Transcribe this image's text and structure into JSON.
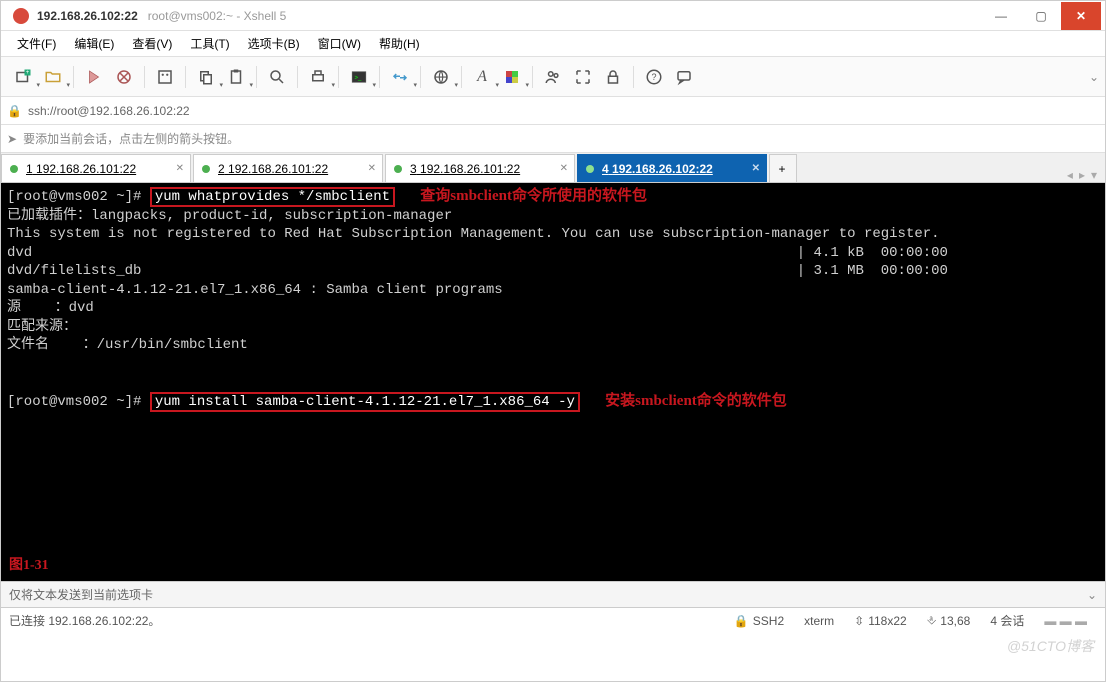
{
  "titlebar": {
    "ip": "192.168.26.102:22",
    "subtitle": "root@vms002:~ - Xshell 5"
  },
  "menu": [
    "文件(F)",
    "编辑(E)",
    "查看(V)",
    "工具(T)",
    "选项卡(B)",
    "窗口(W)",
    "帮助(H)"
  ],
  "address": "ssh://root@192.168.26.102:22",
  "hint": "要添加当前会话，点击左侧的箭头按钮。",
  "tabs": [
    {
      "num": "1",
      "label": "192.168.26.101:22"
    },
    {
      "num": "2",
      "label": "192.168.26.101:22"
    },
    {
      "num": "3",
      "label": "192.168.26.101:22"
    },
    {
      "num": "4",
      "label": "192.168.26.102:22"
    }
  ],
  "term": {
    "prompt1": "[root@vms002 ~]# ",
    "cmd1": "yum whatprovides */smbclient",
    "anno1": "查询smbclient命令所使用的软件包",
    "out_lines": [
      "已加载插件：langpacks, product-id, subscription-manager",
      "This system is not registered to Red Hat Subscription Management. You can use subscription-manager to register.",
      "dvd                                                                                           | 4.1 kB  00:00:00",
      "dvd/filelists_db                                                                              | 3.1 MB  00:00:00",
      "samba-client-4.1.12-21.el7_1.x86_64 : Samba client programs",
      "源    ：dvd",
      "匹配来源：",
      "文件名    ：/usr/bin/smbclient"
    ],
    "prompt2": "[root@vms002 ~]# ",
    "cmd2": "yum install samba-client-4.1.12-21.el7_1.x86_64 -y",
    "anno2": "安装smbclient命令的软件包",
    "fig": "图1-31"
  },
  "statustop": {
    "left": "仅将文本发送到当前选项卡"
  },
  "status": {
    "left": "已连接 192.168.26.102:22。",
    "proto": "SSH2",
    "term": "xterm",
    "size": "118x22",
    "cursor": "13,68",
    "sessions": "4 会话"
  },
  "watermark": "@51CTO博客"
}
